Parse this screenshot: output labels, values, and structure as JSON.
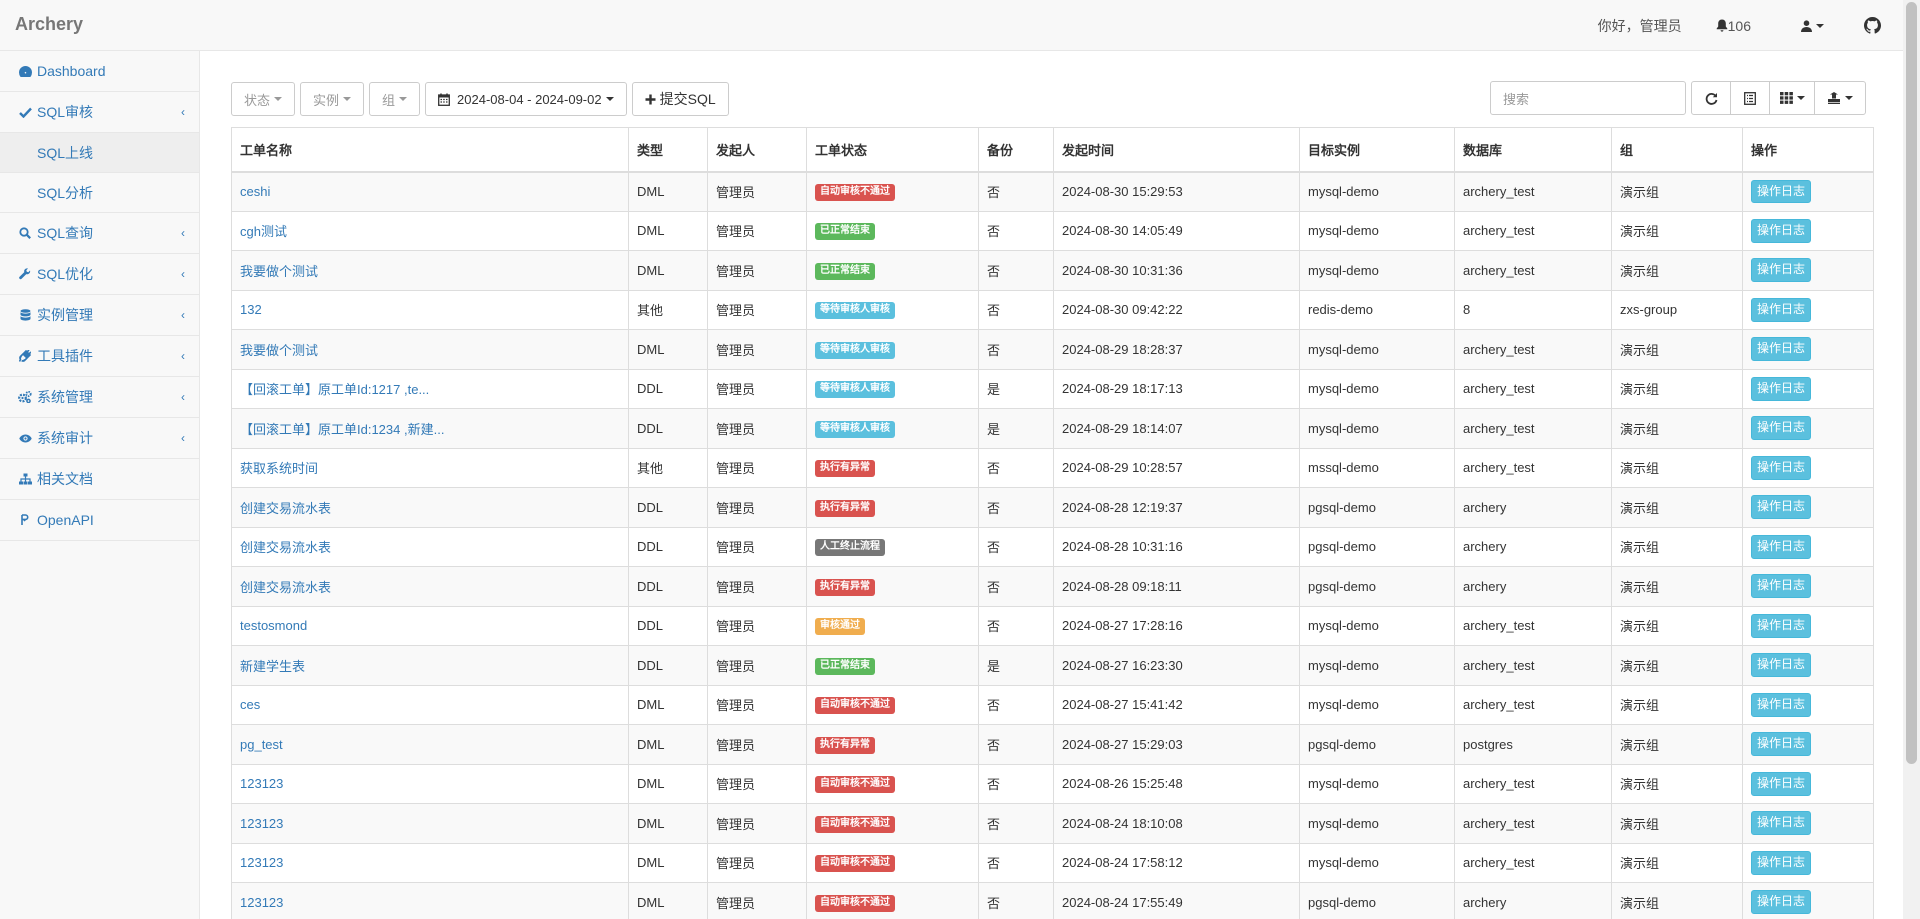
{
  "app": {
    "brand": "Archery"
  },
  "navbar": {
    "greeting": "你好，管理员",
    "notification_count": "106"
  },
  "sidebar": {
    "items": [
      {
        "label": "Dashboard",
        "icon": "dashboard-icon",
        "has_children": false
      },
      {
        "label": "SQL审核",
        "icon": "check-icon",
        "has_children": true,
        "children": [
          {
            "label": "SQL上线",
            "active": true
          },
          {
            "label": "SQL分析",
            "active": false
          }
        ]
      },
      {
        "label": "SQL查询",
        "icon": "search-icon",
        "has_children": true
      },
      {
        "label": "SQL优化",
        "icon": "wrench-icon",
        "has_children": true
      },
      {
        "label": "实例管理",
        "icon": "database-icon",
        "has_children": true
      },
      {
        "label": "工具插件",
        "icon": "plug-icon",
        "has_children": true
      },
      {
        "label": "系统管理",
        "icon": "cogs-icon",
        "has_children": true
      },
      {
        "label": "系统审计",
        "icon": "eye-icon",
        "has_children": true
      },
      {
        "label": "相关文档",
        "icon": "sitemap-icon",
        "has_children": false
      },
      {
        "label": "OpenAPI",
        "icon": "api-icon",
        "has_children": false
      }
    ]
  },
  "toolbar": {
    "status_filter": "状态",
    "instance_filter": "实例",
    "group_filter": "组",
    "date_range": "2024-08-04 - 2024-09-02",
    "submit_label": "提交SQL",
    "search_placeholder": "搜索"
  },
  "table": {
    "columns": [
      "工单名称",
      "类型",
      "发起人",
      "工单状态",
      "备份",
      "发起时间",
      "目标实例",
      "数据库",
      "组",
      "操作"
    ],
    "action_label": "操作日志",
    "status_colors": {
      "自动审核不通过": "#d9534f",
      "已正常结束": "#5cb85c",
      "等待审核人审核": "#5bc0de",
      "执行有异常": "#d9534f",
      "人工终止流程": "#777777",
      "审核通过": "#f0ad4e"
    },
    "rows": [
      {
        "name": "ceshi",
        "type": "DML",
        "user": "管理员",
        "status": "自动审核不通过",
        "backup": "否",
        "time": "2024-08-30 15:29:53",
        "instance": "mysql-demo",
        "db": "archery_test",
        "group": "演示组"
      },
      {
        "name": "cgh测试",
        "type": "DML",
        "user": "管理员",
        "status": "已正常结束",
        "backup": "否",
        "time": "2024-08-30 14:05:49",
        "instance": "mysql-demo",
        "db": "archery_test",
        "group": "演示组"
      },
      {
        "name": "我要做个测试",
        "type": "DML",
        "user": "管理员",
        "status": "已正常结束",
        "backup": "否",
        "time": "2024-08-30 10:31:36",
        "instance": "mysql-demo",
        "db": "archery_test",
        "group": "演示组"
      },
      {
        "name": "132",
        "type": "其他",
        "user": "管理员",
        "status": "等待审核人审核",
        "backup": "否",
        "time": "2024-08-30 09:42:22",
        "instance": "redis-demo",
        "db": "8",
        "group": "zxs-group"
      },
      {
        "name": "我要做个测试",
        "type": "DML",
        "user": "管理员",
        "status": "等待审核人审核",
        "backup": "否",
        "time": "2024-08-29 18:28:37",
        "instance": "mysql-demo",
        "db": "archery_test",
        "group": "演示组"
      },
      {
        "name": "【回滚工单】原工单Id:1217 ,te...",
        "type": "DDL",
        "user": "管理员",
        "status": "等待审核人审核",
        "backup": "是",
        "time": "2024-08-29 18:17:13",
        "instance": "mysql-demo",
        "db": "archery_test",
        "group": "演示组"
      },
      {
        "name": "【回滚工单】原工单Id:1234 ,新建...",
        "type": "DDL",
        "user": "管理员",
        "status": "等待审核人审核",
        "backup": "是",
        "time": "2024-08-29 18:14:07",
        "instance": "mysql-demo",
        "db": "archery_test",
        "group": "演示组"
      },
      {
        "name": "获取系统时间",
        "type": "其他",
        "user": "管理员",
        "status": "执行有异常",
        "backup": "否",
        "time": "2024-08-29 10:28:57",
        "instance": "mssql-demo",
        "db": "archery_test",
        "group": "演示组"
      },
      {
        "name": "创建交易流水表",
        "type": "DDL",
        "user": "管理员",
        "status": "执行有异常",
        "backup": "否",
        "time": "2024-08-28 12:19:37",
        "instance": "pgsql-demo",
        "db": "archery",
        "group": "演示组"
      },
      {
        "name": "创建交易流水表",
        "type": "DDL",
        "user": "管理员",
        "status": "人工终止流程",
        "backup": "否",
        "time": "2024-08-28 10:31:16",
        "instance": "pgsql-demo",
        "db": "archery",
        "group": "演示组"
      },
      {
        "name": "创建交易流水表",
        "type": "DDL",
        "user": "管理员",
        "status": "执行有异常",
        "backup": "否",
        "time": "2024-08-28 09:18:11",
        "instance": "pgsql-demo",
        "db": "archery",
        "group": "演示组"
      },
      {
        "name": "testosmond",
        "type": "DDL",
        "user": "管理员",
        "status": "审核通过",
        "backup": "否",
        "time": "2024-08-27 17:28:16",
        "instance": "mysql-demo",
        "db": "archery_test",
        "group": "演示组"
      },
      {
        "name": "新建学生表",
        "type": "DDL",
        "user": "管理员",
        "status": "已正常结束",
        "backup": "是",
        "time": "2024-08-27 16:23:30",
        "instance": "mysql-demo",
        "db": "archery_test",
        "group": "演示组"
      },
      {
        "name": "ces",
        "type": "DML",
        "user": "管理员",
        "status": "自动审核不通过",
        "backup": "否",
        "time": "2024-08-27 15:41:42",
        "instance": "mysql-demo",
        "db": "archery_test",
        "group": "演示组"
      },
      {
        "name": "pg_test",
        "type": "DML",
        "user": "管理员",
        "status": "执行有异常",
        "backup": "否",
        "time": "2024-08-27 15:29:03",
        "instance": "pgsql-demo",
        "db": "postgres",
        "group": "演示组"
      },
      {
        "name": "123123",
        "type": "DML",
        "user": "管理员",
        "status": "自动审核不通过",
        "backup": "否",
        "time": "2024-08-26 15:25:48",
        "instance": "mysql-demo",
        "db": "archery_test",
        "group": "演示组"
      },
      {
        "name": "123123",
        "type": "DML",
        "user": "管理员",
        "status": "自动审核不通过",
        "backup": "否",
        "time": "2024-08-24 18:10:08",
        "instance": "mysql-demo",
        "db": "archery_test",
        "group": "演示组"
      },
      {
        "name": "123123",
        "type": "DML",
        "user": "管理员",
        "status": "自动审核不通过",
        "backup": "否",
        "time": "2024-08-24 17:58:12",
        "instance": "mysql-demo",
        "db": "archery_test",
        "group": "演示组"
      },
      {
        "name": "123123",
        "type": "DML",
        "user": "管理员",
        "status": "自动审核不通过",
        "backup": "否",
        "time": "2024-08-24 17:55:49",
        "instance": "pgsql-demo",
        "db": "archery",
        "group": "演示组"
      }
    ]
  }
}
